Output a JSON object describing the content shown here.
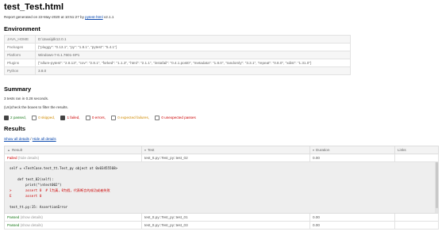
{
  "title": "test_Test.html",
  "generated": {
    "prefix": "Report generated on 22-May-2020 at 10:51:27 by",
    "link": "pytest-html",
    "version": "v2.1.1"
  },
  "environment": {
    "heading": "Environment",
    "rows": [
      {
        "key": "JAVA_HOME",
        "value": "D:\\Java\\jdk12.0.1"
      },
      {
        "key": "Packages",
        "value": "{\"pluggy\": \"0.13.1\", \"py\": \"1.8.1\", \"pytest\": \"5.4.1\"}"
      },
      {
        "key": "Platform",
        "value": "Windows-7-6.1.7601-SP1"
      },
      {
        "key": "Plugins",
        "value": "{\"allure-pytest\": \"2.8.13\", \"cov\": \"2.8.1\", \"forked\": \"1.1.3\", \"html\": \"2.1.1\", \"instafail\": \"0.4.1.post0\", \"metadata\": \"1.8.0\", \"randomly\": \"3.3.1\", \"repeat\": \"0.8.0\", \"xdist\": \"1.31.0\"}"
      },
      {
        "key": "Python",
        "value": "3.8.0"
      }
    ]
  },
  "summary": {
    "heading": "Summary",
    "ran": "3 tests ran in 0.28 seconds.",
    "hint": "(Un)check the boxes to filter the results.",
    "filters": {
      "passed": "2 passed,",
      "skipped": "0 skipped,",
      "failed": "1 failed,",
      "errors": "0 errors,",
      "xfailed": "0 expected failures,",
      "xpassed": "0 unexpected passes"
    }
  },
  "results": {
    "heading": "Results",
    "show_all": "Show all details",
    "separator": "/",
    "hide_all": "Hide all details",
    "columns": {
      "result": "Result",
      "test": "Test",
      "duration": "Duration",
      "links": "Links"
    },
    "rows": [
      {
        "result": "Failed",
        "details": "(hide details)",
        "test": "test_tt.py::Test_py::test_02",
        "duration": "0.00",
        "links": ""
      },
      {
        "result": "Passed",
        "details": "(show details)",
        "test": "test_tt.py::Test_py::test_01",
        "duration": "0.00",
        "links": ""
      },
      {
        "result": "Passed",
        "details": "(show details)",
        "test": "test_tt.py::Test_py::test_03",
        "duration": "0.00",
        "links": ""
      }
    ],
    "log": {
      "line1": "self = <TestCase.test_tt.Test_py object at 0x03455568>",
      "line2": "    def test_02(self):",
      "line3": "        print(\"\\ntest002\")",
      "line4": ">       assert 0  # 1为真，0为假，代表断言的成功或者失败",
      "line5": "E       assert 0",
      "line6": "test_tt.py:15: AssertionError"
    }
  }
}
